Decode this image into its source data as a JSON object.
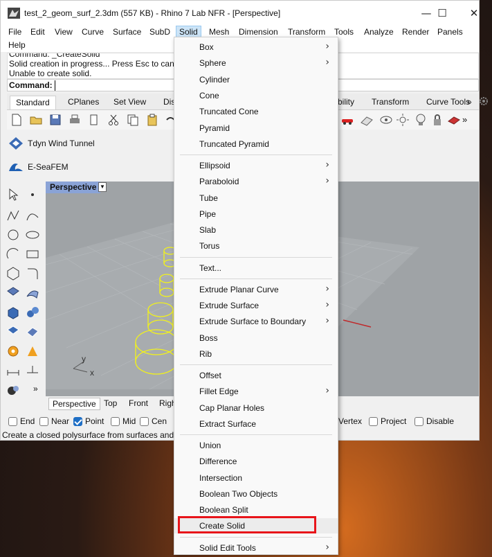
{
  "window": {
    "title": "test_2_geom_surf_2.3dm (557 KB) - Rhino 7 Lab NFR - [Perspective]",
    "controls": {
      "minimize": "—",
      "maximize": "☐",
      "close": "✕"
    }
  },
  "menubar": {
    "items": [
      "File",
      "Edit",
      "View",
      "Curve",
      "Surface",
      "SubD",
      "Solid",
      "Mesh",
      "Dimension",
      "Transform",
      "Tools",
      "Analyze",
      "Render",
      "Panels",
      "Help"
    ],
    "active": "Solid"
  },
  "history": {
    "lines": [
      "Command: _CreateSolid",
      "Solid creation in progress... Press Esc to cancel",
      "Unable to create solid."
    ]
  },
  "command": {
    "label": "Command:",
    "value": ""
  },
  "toolbar_tabs": {
    "left": [
      "Standard",
      "CPlanes",
      "Set View",
      "Dis"
    ],
    "right": [
      "bility",
      "Transform",
      "Curve Tools"
    ],
    "overflow": "»"
  },
  "plugins": [
    {
      "label": "Tdyn Wind Tunnel",
      "icon": "tdyn-icon"
    },
    {
      "label": "E-SeaFEM",
      "icon": "seafem-icon"
    }
  ],
  "viewport": {
    "title": "Perspective",
    "axis_labels": {
      "y": "y",
      "x": "x"
    },
    "tabs": [
      "Perspective",
      "Top",
      "Front",
      "Righ"
    ]
  },
  "osnap": {
    "left": [
      {
        "label": "End",
        "checked": false
      },
      {
        "label": "Near",
        "checked": false
      },
      {
        "label": "Point",
        "checked": true
      },
      {
        "label": "Mid",
        "checked": false
      },
      {
        "label": "Cen",
        "checked": false
      }
    ],
    "right": [
      {
        "label": "Vertex",
        "checked": false
      },
      {
        "label": "Project",
        "checked": false
      },
      {
        "label": "Disable",
        "checked": false
      }
    ]
  },
  "status": {
    "text": "Create a closed polysurface from surfaces and"
  },
  "solid_menu": {
    "groups": [
      [
        {
          "label": "Box",
          "submenu": true
        },
        {
          "label": "Sphere",
          "submenu": true
        },
        {
          "label": "Cylinder",
          "submenu": false
        },
        {
          "label": "Cone",
          "submenu": false
        },
        {
          "label": "Truncated Cone",
          "submenu": false
        },
        {
          "label": "Pyramid",
          "submenu": false
        },
        {
          "label": "Truncated Pyramid",
          "submenu": false
        }
      ],
      [
        {
          "label": "Ellipsoid",
          "submenu": true
        },
        {
          "label": "Paraboloid",
          "submenu": true
        },
        {
          "label": "Tube",
          "submenu": false
        },
        {
          "label": "Pipe",
          "submenu": false
        },
        {
          "label": "Slab",
          "submenu": false
        },
        {
          "label": "Torus",
          "submenu": false
        }
      ],
      [
        {
          "label": "Text...",
          "submenu": false
        }
      ],
      [
        {
          "label": "Extrude Planar Curve",
          "submenu": true
        },
        {
          "label": "Extrude Surface",
          "submenu": true
        },
        {
          "label": "Extrude Surface to Boundary",
          "submenu": true
        },
        {
          "label": "Boss",
          "submenu": false
        },
        {
          "label": "Rib",
          "submenu": false
        }
      ],
      [
        {
          "label": "Offset",
          "submenu": false
        },
        {
          "label": "Fillet Edge",
          "submenu": true
        },
        {
          "label": "Cap Planar Holes",
          "submenu": false
        },
        {
          "label": "Extract Surface",
          "submenu": false
        }
      ],
      [
        {
          "label": "Union",
          "submenu": false
        },
        {
          "label": "Difference",
          "submenu": false
        },
        {
          "label": "Intersection",
          "submenu": false
        },
        {
          "label": "Boolean Two Objects",
          "submenu": false
        },
        {
          "label": "Boolean Split",
          "submenu": false
        },
        {
          "label": "Create Solid",
          "submenu": false,
          "highlighted": true
        }
      ],
      [
        {
          "label": "Solid Edit Tools",
          "submenu": true
        }
      ]
    ],
    "submenu_arrow": "›"
  },
  "colors": {
    "annotation_box": "#e8141a",
    "viewport_bg": "#9fa3a6",
    "viewport_title_bg": "#8aa3d6",
    "selected_geometry": "#f2f21a"
  }
}
